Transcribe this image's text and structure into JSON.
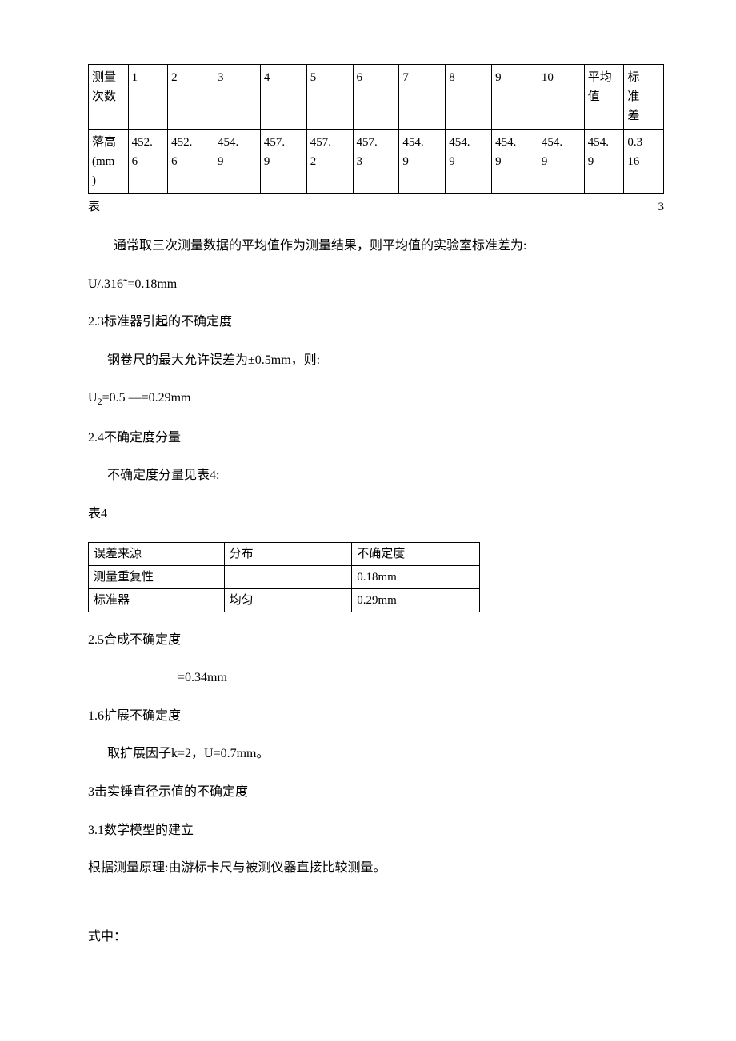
{
  "table3": {
    "header": {
      "label": "测量\n次数",
      "cols": [
        "1",
        "2",
        "3",
        "4",
        "5",
        "6",
        "7",
        "8",
        "9",
        "10",
        "平均\n值",
        "标\n准\n差"
      ]
    },
    "row": {
      "label": "落高\n(mm\n)",
      "vals": [
        "452.\n6",
        "452.\n6",
        "454.\n9",
        "457.\n9",
        "457.\n2",
        "457.\n3",
        "454.\n9",
        "454.\n9",
        "454.\n9",
        "454.\n9",
        "454.\n9",
        "0.3\n16"
      ]
    },
    "caption_left": "表",
    "caption_right": "3"
  },
  "p1": "通常取三次测量数据的平均值作为测量结果，则平均值的实验室标准差为:",
  "p2": "U/.316˜=0.18mm",
  "p3": "2.3标准器引起的不确定度",
  "p4": "钢卷尺的最大允许误差为±0.5mm，则:",
  "p5_pre": "U",
  "p5_sub": "2",
  "p5_post": "=0.5 —=0.29mm",
  "p6": "2.4不确定度分量",
  "p7": "不确定度分量见表4:",
  "p8": "表4",
  "table4": {
    "r1": [
      "误差来源",
      "分布",
      "不确定度"
    ],
    "r2": [
      "测量重复性",
      "",
      "0.18mm"
    ],
    "r3": [
      "标准器",
      "均匀",
      "0.29mm"
    ]
  },
  "p9": "2.5合成不确定度",
  "p10": "=0.34mm",
  "p11": "1.6扩展不确定度",
  "p12": "取扩展因子k=2，U=0.7mm。",
  "p13": "3击实锤直径示值的不确定度",
  "p14": " 3.1数学模型的建立",
  "p15": "根据测量原理:由游标卡尺与被测仪器直接比较测量。",
  "p16": "式中："
}
